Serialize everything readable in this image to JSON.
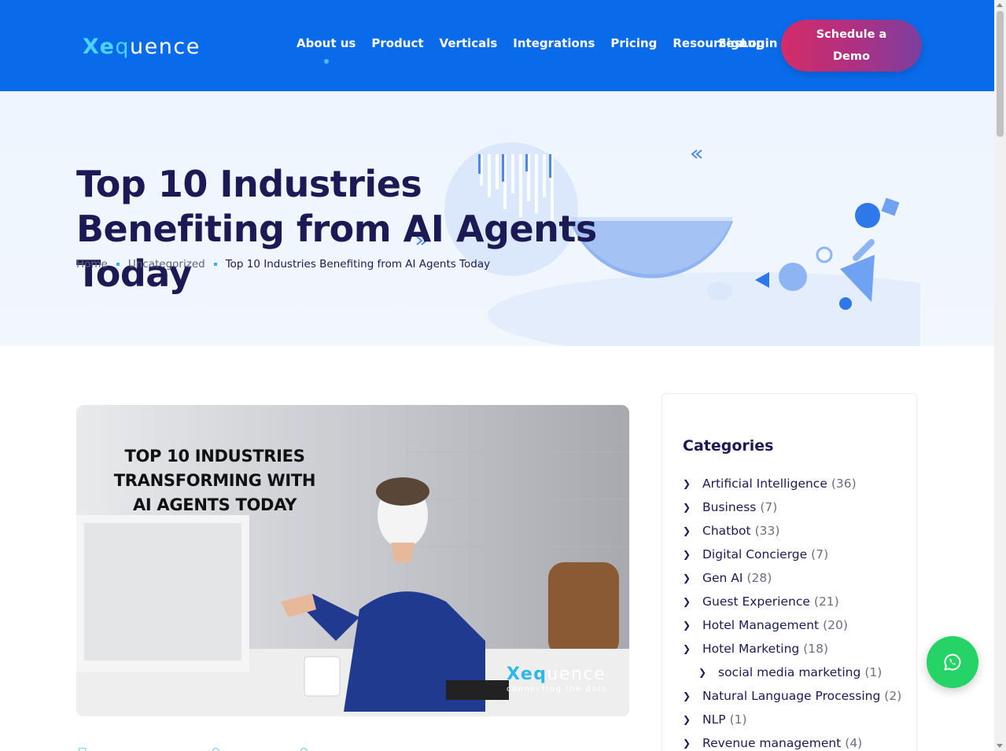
{
  "header": {
    "logo": {
      "prefix": "Xe",
      "mid": "q",
      "suffix": "uence"
    },
    "nav": [
      {
        "label": "About us",
        "active": true
      },
      {
        "label": "Product"
      },
      {
        "label": "Verticals"
      },
      {
        "label": "Integrations"
      },
      {
        "label": "Pricing"
      },
      {
        "label": "Resources"
      }
    ],
    "signup_label": "Signup",
    "login_label": "Login",
    "cta_line1": "Schedule a",
    "cta_line2": "Demo"
  },
  "hero": {
    "title": "Top 10 Industries Benefiting from AI Agents Today",
    "breadcrumb": [
      "Home",
      "Uncategorized",
      "Top 10 Industries Benefiting from AI Agents Today"
    ]
  },
  "featured_image": {
    "headline_lines": [
      "TOP 10 INDUSTRIES",
      "TRANSFORMING WITH",
      "AI AGENTS TODAY"
    ],
    "logo": {
      "prefix": "Xe",
      "mid": "q",
      "suffix": "uence"
    },
    "tagline": "connecting the dots"
  },
  "sidebar": {
    "title": "Categories",
    "categories": [
      {
        "name": "Artificial Intelligence",
        "count": "(36)"
      },
      {
        "name": "Business",
        "count": "(7)"
      },
      {
        "name": "Chatbot",
        "count": "(33)"
      },
      {
        "name": "Digital Concierge",
        "count": "(7)"
      },
      {
        "name": "Gen AI",
        "count": "(28)"
      },
      {
        "name": "Guest Experience",
        "count": "(21)"
      },
      {
        "name": "Hotel Management",
        "count": "(20)"
      },
      {
        "name": "Hotel Marketing",
        "count": "(18)"
      },
      {
        "name": "social media marketing",
        "count": "(1)",
        "sub": true
      },
      {
        "name": "Natural Language Processing",
        "count": "(2)"
      },
      {
        "name": "NLP",
        "count": "(1)"
      },
      {
        "name": "Revenue management",
        "count": "(4)"
      }
    ]
  },
  "colors": {
    "header_bg": "#0a6bea",
    "title": "#1c1a55",
    "accent": "#2fb7e8",
    "whatsapp": "#25d366"
  },
  "icons": [
    "whatsapp-icon",
    "chevron-right-icon",
    "calendar-icon",
    "user-icon",
    "comment-icon"
  ]
}
